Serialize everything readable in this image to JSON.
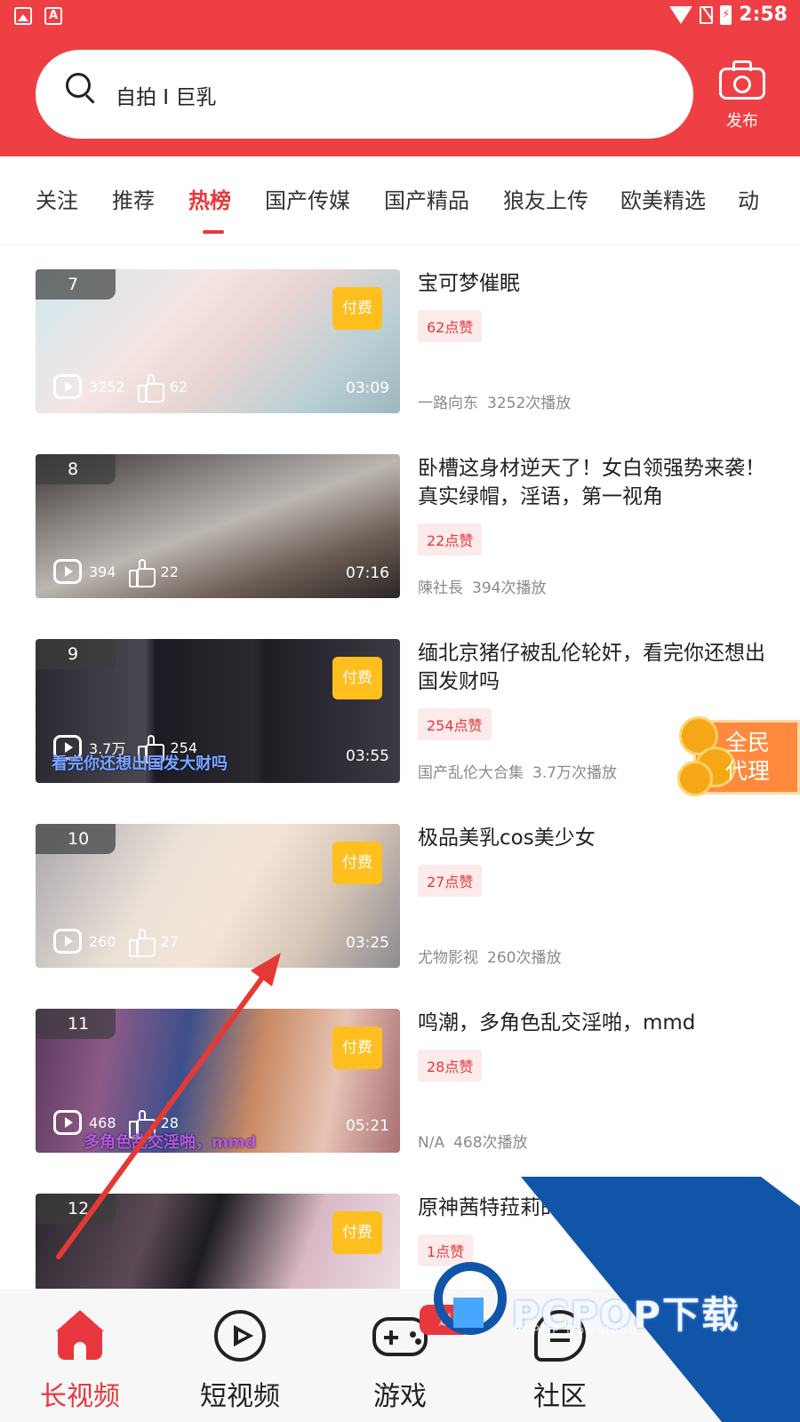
{
  "status_bar": {
    "time": "2:58",
    "left_icons": [
      "image-icon",
      "a-icon"
    ],
    "right_icons": [
      "wifi-icon",
      "no-sim-icon",
      "battery-icon"
    ]
  },
  "header": {
    "search_text": "自拍 I 巨乳",
    "publish_label": "发布",
    "background_color": "#ee3f44"
  },
  "tabs": [
    {
      "label": "关注",
      "active": false
    },
    {
      "label": "推荐",
      "active": false
    },
    {
      "label": "热榜",
      "active": true
    },
    {
      "label": "国产传媒",
      "active": false
    },
    {
      "label": "国产精品",
      "active": false
    },
    {
      "label": "狼友上传",
      "active": false
    },
    {
      "label": "欧美精选",
      "active": false
    },
    {
      "label": "动",
      "active": false
    }
  ],
  "videos": [
    {
      "rank": "7",
      "title": "宝可梦催眠",
      "paid": true,
      "pay_label": "付费",
      "plays": "3252",
      "likes": "62",
      "duration": "03:09",
      "likes_tag": "62点赞",
      "author": "一路向东",
      "play_count": "3252次播放"
    },
    {
      "rank": "8",
      "title": "卧槽这身材逆天了！女白领强势来袭！真实绿帽，淫语，第一视角",
      "paid": false,
      "plays": "394",
      "likes": "22",
      "duration": "07:16",
      "likes_tag": "22点赞",
      "author": "陳社長",
      "play_count": "394次播放"
    },
    {
      "rank": "9",
      "title": "缅北京猪仔被乱伦轮奸，看完你还想出国发财吗",
      "paid": true,
      "pay_label": "付费",
      "plays": "3.7万",
      "likes": "254",
      "duration": "03:55",
      "likes_tag": "254点赞",
      "author": "国产乱伦大合集",
      "play_count": "3.7万次播放",
      "caption": "看完你还想出国发大财吗"
    },
    {
      "rank": "10",
      "title": "极品美乳cos美少女",
      "paid": true,
      "pay_label": "付费",
      "plays": "260",
      "likes": "27",
      "duration": "03:25",
      "likes_tag": "27点赞",
      "author": "尤物影视",
      "play_count": "260次播放"
    },
    {
      "rank": "11",
      "title": "鸣潮，多角色乱交淫啪，mmd",
      "paid": true,
      "pay_label": "付费",
      "plays": "468",
      "likes": "28",
      "duration": "05:21",
      "likes_tag": "28点赞",
      "author": "N/A",
      "play_count": "468次播放",
      "caption": "多角色乱交淫啪，mmd"
    },
    {
      "rank": "12",
      "title": "原神茜特菈莉的",
      "paid": true,
      "pay_label": "付费",
      "likes_tag": "1点赞"
    }
  ],
  "agent_badge": {
    "line1": "全民",
    "line2": "代理"
  },
  "watermark": {
    "brand": "PCPOP下载",
    "sub": "PCPOP Download"
  },
  "bottom_nav": [
    {
      "label": "长视频",
      "icon": "home-icon",
      "active": true
    },
    {
      "label": "短视频",
      "icon": "play-circle-icon",
      "active": false
    },
    {
      "label": "游戏",
      "icon": "gamepad-icon",
      "active": false,
      "badge": "送"
    },
    {
      "label": "社区",
      "icon": "chat-bubble-icon",
      "active": false
    }
  ],
  "colors": {
    "accent": "#e8383d",
    "pay_badge": "#ffbf1f",
    "likes_tag_bg": "#fdeaea"
  }
}
